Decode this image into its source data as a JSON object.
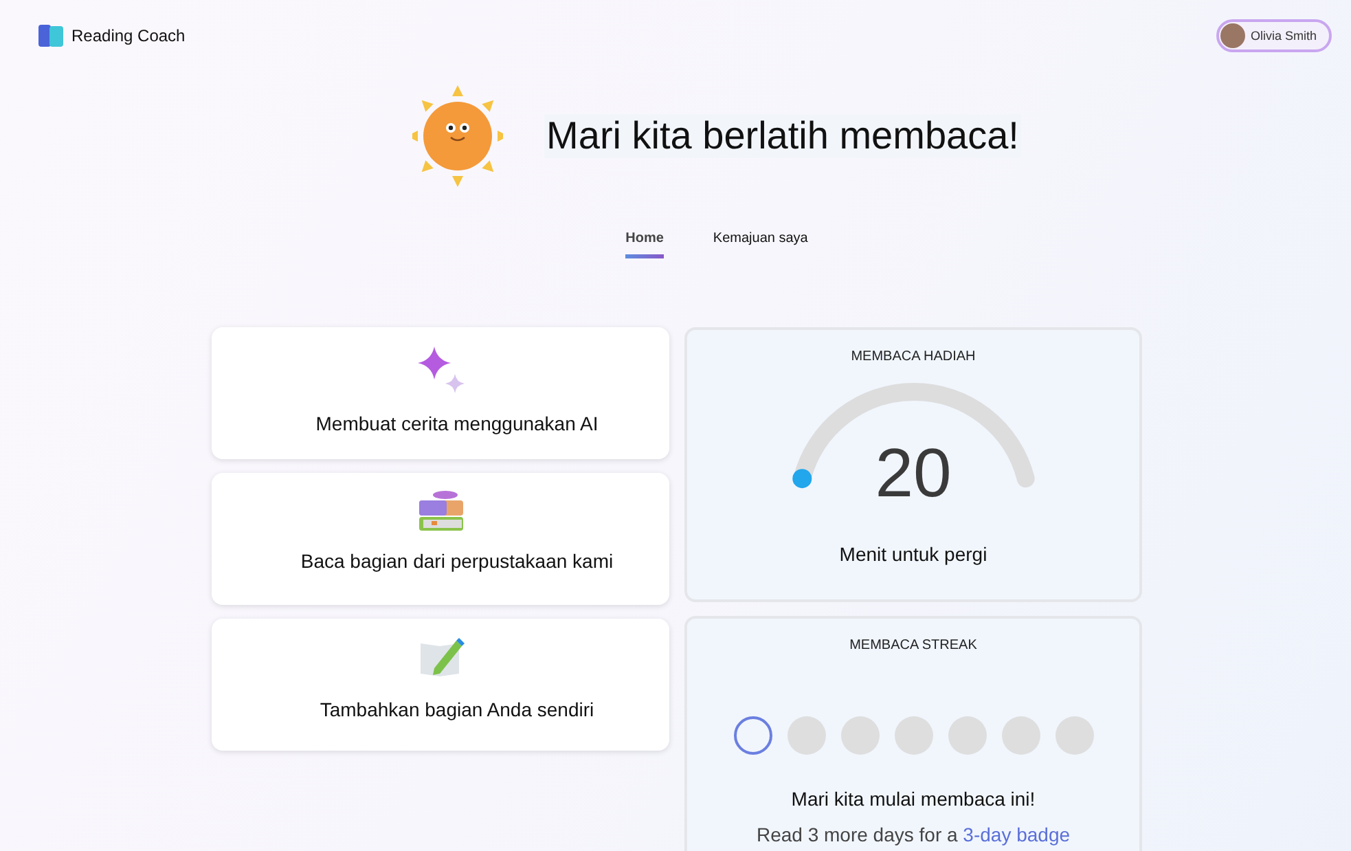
{
  "app": {
    "name": "Reading Coach"
  },
  "user": {
    "name": "Olivia Smith"
  },
  "hero": {
    "title": "Mari kita berlatih membaca!"
  },
  "tabs": [
    {
      "label": "Home",
      "selected": true
    },
    {
      "label": "Kemajuan saya",
      "selected": false
    }
  ],
  "actions": [
    {
      "kind": "sparkle",
      "label": "Membuat cerita menggunakan AI"
    },
    {
      "kind": "books",
      "label": "Baca bagian dari perpustakaan kami"
    },
    {
      "kind": "pencil",
      "label": "Tambahkan bagian Anda sendiri"
    }
  ],
  "reward": {
    "title": "MEMBACA HADIAH",
    "value": "20",
    "level": 0,
    "caption": "Menit untuk pergi"
  },
  "streak": {
    "title": "MEMBACA STREAK",
    "days": [
      {
        "current": true,
        "done": false
      },
      {
        "current": false,
        "done": false
      },
      {
        "current": false,
        "done": false
      },
      {
        "current": false,
        "done": false
      },
      {
        "current": false,
        "done": false
      },
      {
        "current": false,
        "done": false
      },
      {
        "current": false,
        "done": false
      }
    ],
    "message": "Mari kita mulai membaca ini!",
    "note": "Read 3 more days for a",
    "link": "3-day badge"
  }
}
